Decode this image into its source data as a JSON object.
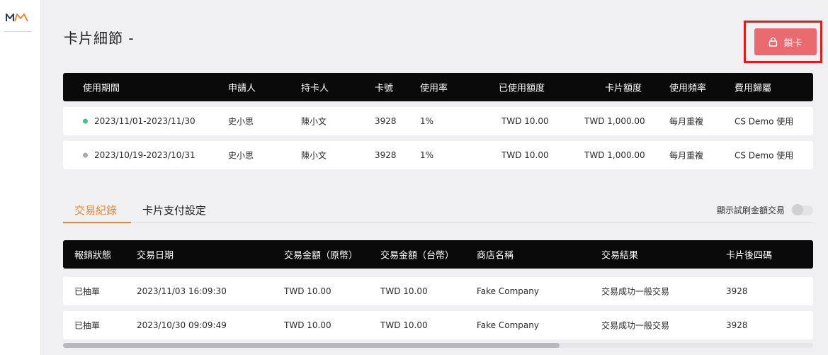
{
  "app": {
    "logo_text": "MM"
  },
  "header": {
    "title": "卡片細節 -",
    "lock_button_label": "鎖卡"
  },
  "period_table": {
    "columns": [
      "使用期間",
      "申請人",
      "持卡人",
      "卡號",
      "使用率",
      "已使用額度",
      "卡片額度",
      "使用頻率",
      "費用歸屬"
    ],
    "rows": [
      {
        "status_color": "#4cba8b",
        "cells": [
          "2023/11/01-2023/11/30",
          "史小思",
          "陳小文",
          "3928",
          "1%",
          "TWD 10.00",
          "TWD 1,000.00",
          "每月重複",
          "CS Demo 使用"
        ]
      },
      {
        "status_color": "#a9a9ad",
        "cells": [
          "2023/10/19-2023/10/31",
          "史小思",
          "陳小文",
          "3928",
          "1%",
          "TWD 10.00",
          "TWD 1,000.00",
          "每月重複",
          "CS Demo 使用"
        ]
      }
    ]
  },
  "tabs": {
    "items": [
      {
        "label": "交易紀錄",
        "active": true
      },
      {
        "label": "卡片支付設定",
        "active": false
      }
    ],
    "toggle_label": "顯示試刷金額交易",
    "toggle_on": false
  },
  "transactions_table": {
    "columns": [
      "報銷狀態",
      "交易日期",
      "交易金額（原幣）",
      "交易金額（台幣）",
      "商店名稱",
      "交易結果",
      "卡片後四碼"
    ],
    "rows": [
      [
        "已抽單",
        "2023/11/03 16:09:30",
        "TWD 10.00",
        "TWD 10.00",
        "Fake Company",
        "交易成功一般交易",
        "3928"
      ],
      [
        "已抽單",
        "2023/10/30 09:09:49",
        "TWD 10.00",
        "TWD 10.00",
        "Fake Company",
        "交易成功一般交易",
        "3928"
      ]
    ]
  },
  "colors": {
    "accent": "#e38a3d",
    "lock_button": "#e96a6f",
    "highlight": "#e11b1b",
    "header_bg": "#0a0a0a"
  },
  "icons": {
    "lock": "lock-icon"
  },
  "scroll": {
    "horizontal_position": 0.0,
    "visible_fraction": 0.66
  }
}
